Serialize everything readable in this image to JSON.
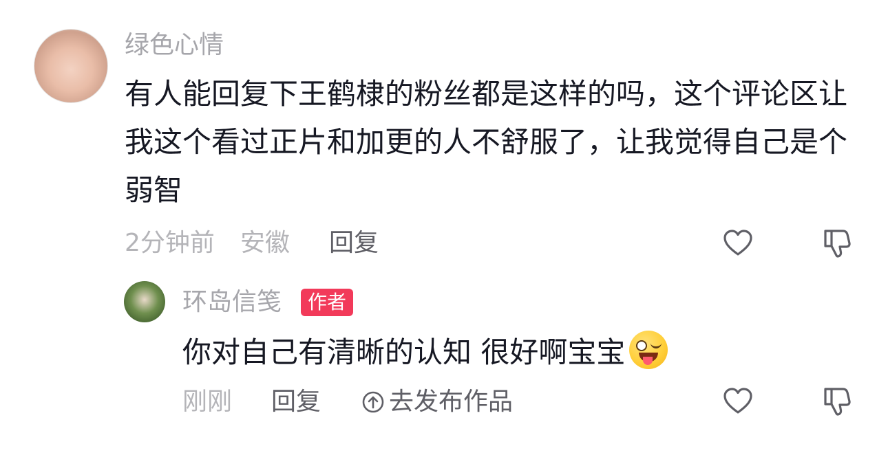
{
  "comment": {
    "username": "绿色心情",
    "text": "有人能回复下王鹤棣的粉丝都是这样的吗，这个评论区让我这个看过正片和加更的人不舒服了，让我觉得自己是个弱智",
    "time": "2分钟前",
    "location": "安徽",
    "reply_label": "回复",
    "avatar": "baby-avatar"
  },
  "reply": {
    "username": "环岛信笺",
    "badge": "作者",
    "text": "你对自己有清晰的认知 很好啊宝宝",
    "emoji": "wink-tongue-emoji",
    "time": "刚刚",
    "reply_label": "回复",
    "publish_label": "去发布作品",
    "avatar": "author-avatar"
  },
  "icons": {
    "like": "heart-outline-icon",
    "dislike": "thumbs-down-outline-icon",
    "publish": "arrow-up-circle-icon"
  },
  "colors": {
    "author_badge": "#f23a5a",
    "username": "#a6a6ab",
    "text": "#161823",
    "meta": "#b4b4b8",
    "action": "#5f5f66"
  }
}
